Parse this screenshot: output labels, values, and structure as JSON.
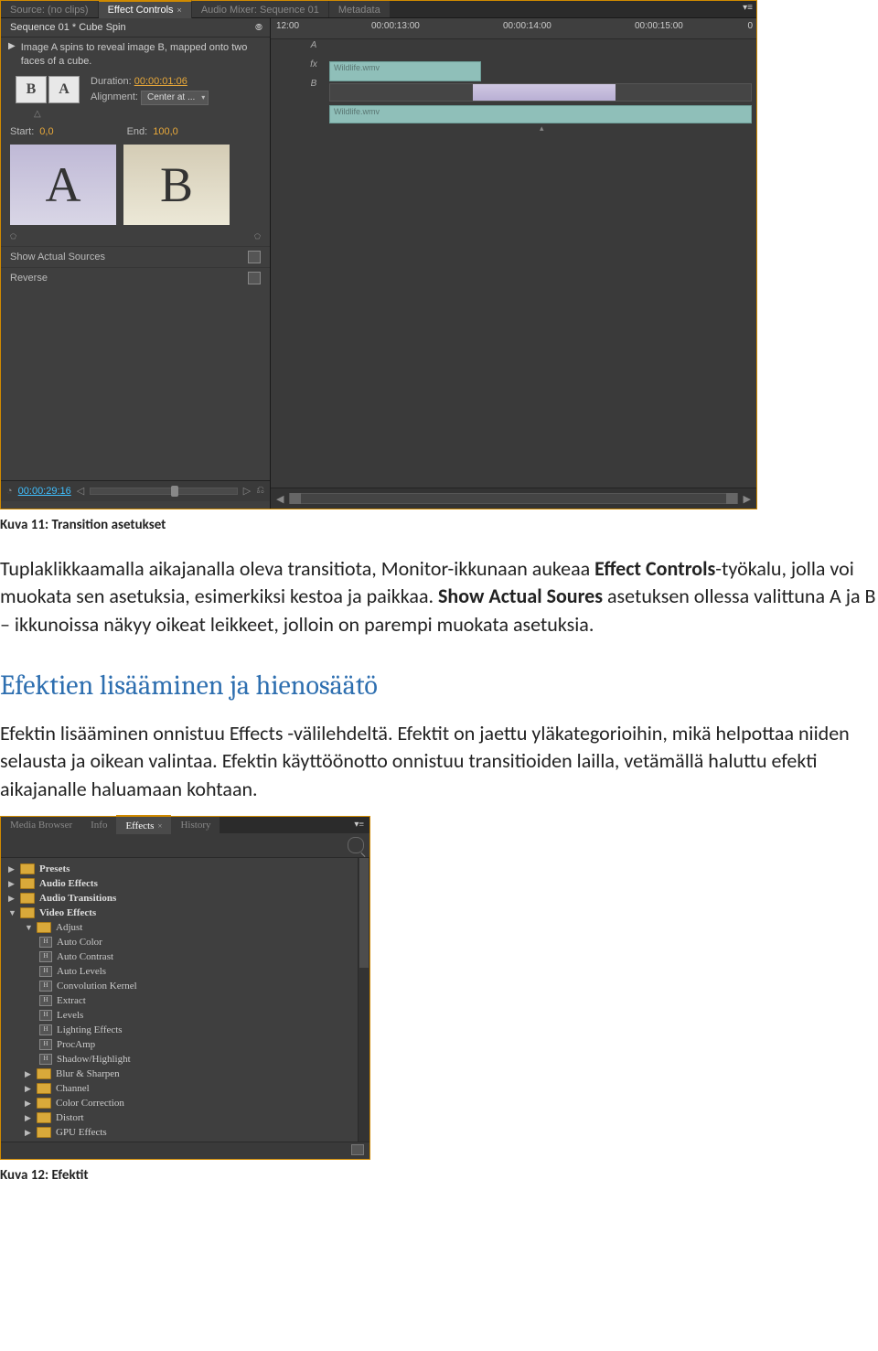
{
  "shot1": {
    "tabs": {
      "source": "Source: (no clips)",
      "effect": "Effect Controls",
      "audio": "Audio Mixer: Sequence 01",
      "meta": "Metadata"
    },
    "seqTitle": "Sequence 01 * Cube Spin",
    "desc": "Image A spins to reveal image B, mapped onto two faces of a cube.",
    "durationLbl": "Duration:",
    "durationVal": "00:00:01:06",
    "alignLbl": "Alignment:",
    "alignVal": "Center at ...",
    "startLbl": "Start:",
    "startVal": "0,0",
    "endLbl": "End:",
    "endVal": "100,0",
    "showActual": "Show Actual Sources",
    "reverse": "Reverse",
    "timecode": "00:00:29:16",
    "timeline": {
      "t0": "12:00",
      "t1": "00:00:13:00",
      "t2": "00:00:14:00",
      "t3": "00:00:15:00",
      "edge": "0"
    },
    "trackA": "A",
    "trackFx": "fx",
    "trackB": "B",
    "clipName": "Wildlife.wmv"
  },
  "caption1": "Kuva 11: Transition asetukset",
  "p1a": "Tuplaklikkaamalla aikajanalla oleva transitiota, Monitor-ikkunaan aukeaa ",
  "p1b": "Effect Controls",
  "p1c": "-työkalu, jolla voi muokata sen asetuksia, esimerkiksi kestoa ja paikkaa. ",
  "p1d": "Show Actual Soures",
  "p1e": " asetuksen ollessa valittuna A ja B – ikkunoissa näkyy oikeat leikkeet, jolloin on parempi muokata asetuksia.",
  "sectionTitle": "Efektien lisääminen ja hienosäätö",
  "p2": "Efektin lisääminen onnistuu Effects -välilehdeltä. Efektit on jaettu yläkategorioihin, mikä helpottaa niiden selausta ja oikean valintaa. Efektin käyttöönotto onnistuu transitioiden lailla, vetämällä haluttu efekti aikajanalle haluamaan kohtaan.",
  "shot2": {
    "tabs": {
      "media": "Media Browser",
      "info": "Info",
      "effects": "Effects",
      "history": "History"
    },
    "presets": "Presets",
    "audioFx": "Audio Effects",
    "audioTr": "Audio Transitions",
    "videoFx": "Video Effects",
    "adjust": "Adjust",
    "items": [
      "Auto Color",
      "Auto Contrast",
      "Auto Levels",
      "Convolution Kernel",
      "Extract",
      "Levels",
      "Lighting Effects",
      "ProcAmp",
      "Shadow/Highlight"
    ],
    "blur": "Blur & Sharpen",
    "channel": "Channel",
    "cc": "Color Correction",
    "distort": "Distort",
    "gpu": "GPU Effects"
  },
  "caption2": "Kuva 12: Efektit"
}
